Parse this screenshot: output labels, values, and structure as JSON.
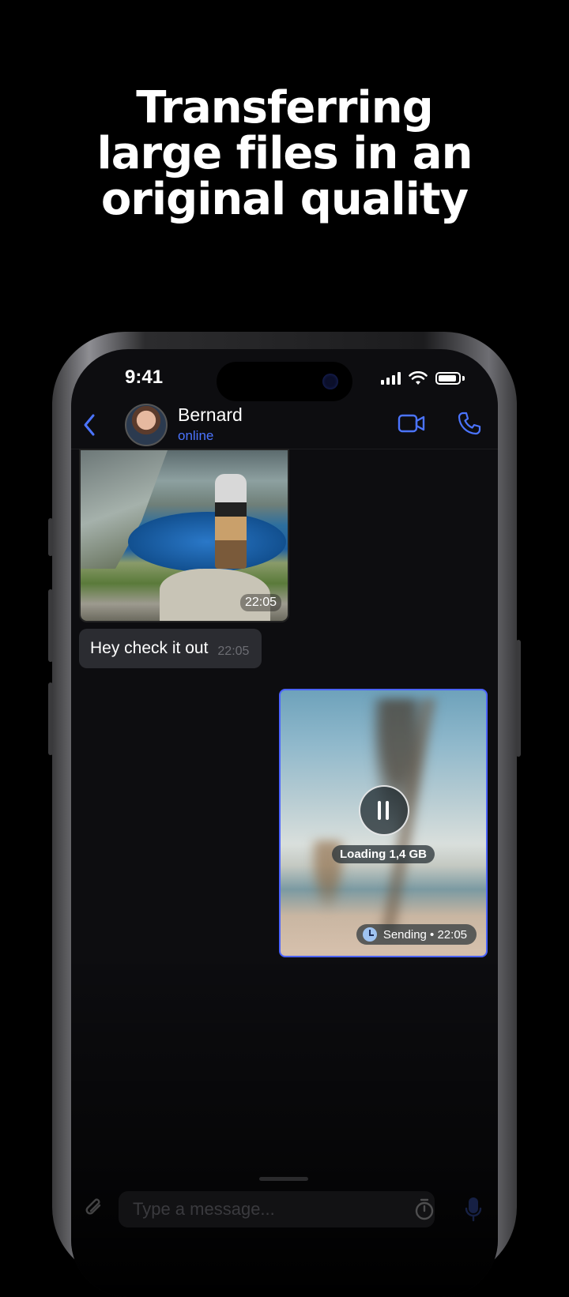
{
  "headline": {
    "line1": "Transferring",
    "line2": "large files in an",
    "line3": "original quality"
  },
  "status_bar": {
    "time": "9:41"
  },
  "chat_header": {
    "name": "Bernard",
    "status": "online"
  },
  "messages": {
    "photo_time": "22:05",
    "text_message": "Hey check it out",
    "text_time": "22:05",
    "video_loading": "Loading 1,4 GB",
    "video_status": "Sending • 22:05",
    "video_progress_state": "paused"
  },
  "composer": {
    "placeholder": "Type a message..."
  },
  "colors": {
    "accent": "#4b74ff",
    "background": "#000000",
    "bubble": "#2b2c31",
    "selection_border": "#4b63ff"
  },
  "icons": [
    "back-icon",
    "video-call-icon",
    "phone-call-icon",
    "pause-icon",
    "clock-icon",
    "attach-icon",
    "timer-icon",
    "mic-icon"
  ]
}
